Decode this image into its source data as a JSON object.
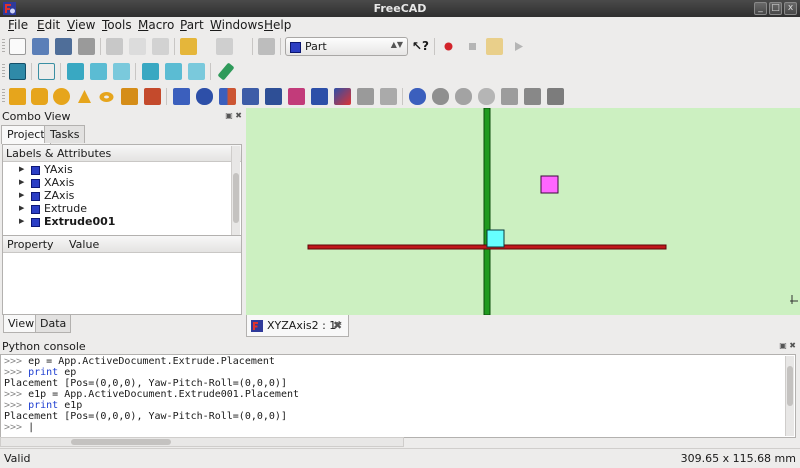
{
  "window": {
    "title": "FreeCAD",
    "buttons": [
      "_",
      "□",
      "x"
    ]
  },
  "menubar": {
    "items": [
      {
        "label": "File",
        "mnemonic": "F",
        "rest": "ile"
      },
      {
        "label": "Edit",
        "mnemonic": "E",
        "rest": "dit"
      },
      {
        "label": "View",
        "mnemonic": "V",
        "rest": "iew"
      },
      {
        "label": "Tools",
        "mnemonic": "T",
        "rest": "ools"
      },
      {
        "label": "Macro",
        "mnemonic": "M",
        "rest": "acro"
      },
      {
        "label": "Part",
        "mnemonic": "P",
        "rest": "art"
      },
      {
        "label": "Windows",
        "mnemonic": "W",
        "rest": "indows"
      },
      {
        "label": "Help",
        "mnemonic": "H",
        "rest": "elp"
      }
    ]
  },
  "toolbar": {
    "workbench": "Part",
    "icons_row1": [
      "new-document-icon",
      "open-folder-icon",
      "save-icon",
      "print-icon",
      "cut-icon",
      "copy-icon",
      "paste-icon",
      "undo-icon",
      "redo-icon",
      "refresh-icon"
    ],
    "icons_row1_right": [
      "whats-this-icon",
      "record-macro-icon",
      "stop-macro-icon",
      "edit-macro-icon",
      "run-macro-icon"
    ],
    "icons_row2": [
      "zoom-fit-icon",
      "view-axo-icon",
      "view-front-icon",
      "view-top-icon",
      "view-right-icon",
      "view-rear-icon",
      "view-bottom-icon",
      "view-left-icon",
      "measure-icon"
    ],
    "icons_row3": [
      "part-box-icon",
      "part-cylinder-icon",
      "part-sphere-icon",
      "part-cone-icon",
      "part-torus-icon",
      "part-primitives-icon",
      "part-shape-builder-icon",
      "part-extrude-icon",
      "part-revolve-icon",
      "part-mirror-icon",
      "part-fillet-icon",
      "part-chamfer-icon",
      "part-make-face-icon",
      "part-ruled-surface-icon",
      "part-loft-icon",
      "part-sweep-icon",
      "part-offset-icon",
      "part-thickness-icon",
      "part-boolean-icon",
      "part-cut-icon",
      "part-fuse-icon",
      "part-common-icon",
      "part-section-icon",
      "part-cross-sections-icon",
      "part-compound-icon"
    ]
  },
  "combo_view": {
    "title": "Combo View",
    "tabs": [
      "Project",
      "Tasks"
    ],
    "tree_header": "Labels & Attributes",
    "tree_items": [
      {
        "label": "YAxis",
        "bold": false
      },
      {
        "label": "XAxis",
        "bold": false
      },
      {
        "label": "ZAxis",
        "bold": false
      },
      {
        "label": "Extrude",
        "bold": false
      },
      {
        "label": "Extrude001",
        "bold": true
      }
    ],
    "property_headers": [
      "Property",
      "Value"
    ],
    "bottom_tabs": [
      "View",
      "Data"
    ]
  },
  "viewport": {
    "background_color": "#ccf0c1",
    "x_axis_color": "#c0161b",
    "z_axis_color": "#1f9a1f",
    "cyan_box_color": "#66ffff",
    "magenta_box_color": "#ff66ff"
  },
  "document_tab": {
    "label": "XYZAxis2 : 1*",
    "close": "✖"
  },
  "python_console": {
    "title": "Python console",
    "lines": [
      {
        "type": "cmd",
        "prompt": ">>> ",
        "text": "ep = App.ActiveDocument.Extrude.Placement"
      },
      {
        "type": "cmd",
        "prompt": ">>> ",
        "keyword": "print",
        "text": " ep"
      },
      {
        "type": "out",
        "text": "Placement [Pos=(0,0,0), Yaw-Pitch-Roll=(0,0,0)]"
      },
      {
        "type": "cmd",
        "prompt": ">>> ",
        "text": "e1p = App.ActiveDocument.Extrude001.Placement"
      },
      {
        "type": "cmd",
        "prompt": ">>> ",
        "keyword": "print",
        "text": " e1p"
      },
      {
        "type": "out",
        "text": "Placement [Pos=(0,0,0), Yaw-Pitch-Roll=(0,0,0)]"
      },
      {
        "type": "cmd",
        "prompt": ">>> ",
        "text": "|"
      }
    ]
  },
  "statusbar": {
    "status": "Valid",
    "dimensions": "309.65 x 115.68 mm"
  }
}
